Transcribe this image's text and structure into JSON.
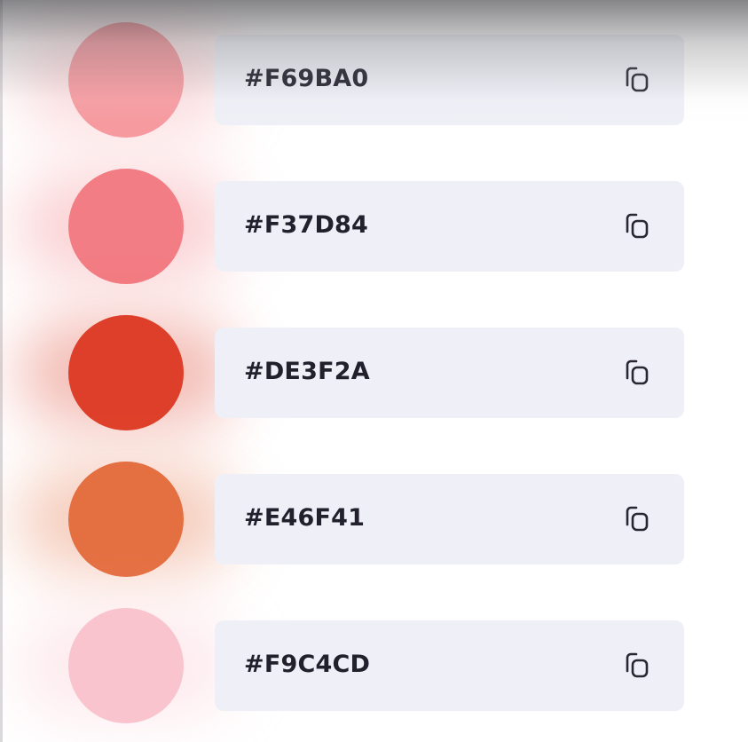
{
  "palette": {
    "colors": [
      {
        "hex": "#F69BA0",
        "swatch": "#F69BA0"
      },
      {
        "hex": "#F37D84",
        "swatch": "#F37D84"
      },
      {
        "hex": "#DE3F2A",
        "swatch": "#DE3F2A"
      },
      {
        "hex": "#E46F41",
        "swatch": "#E46F41"
      },
      {
        "hex": "#F9C4CD",
        "swatch": "#F9C4CD"
      }
    ],
    "copy_icon": "copy-icon"
  },
  "theme": {
    "card_background": "#EFF0F7",
    "text_color": "#22202C"
  }
}
